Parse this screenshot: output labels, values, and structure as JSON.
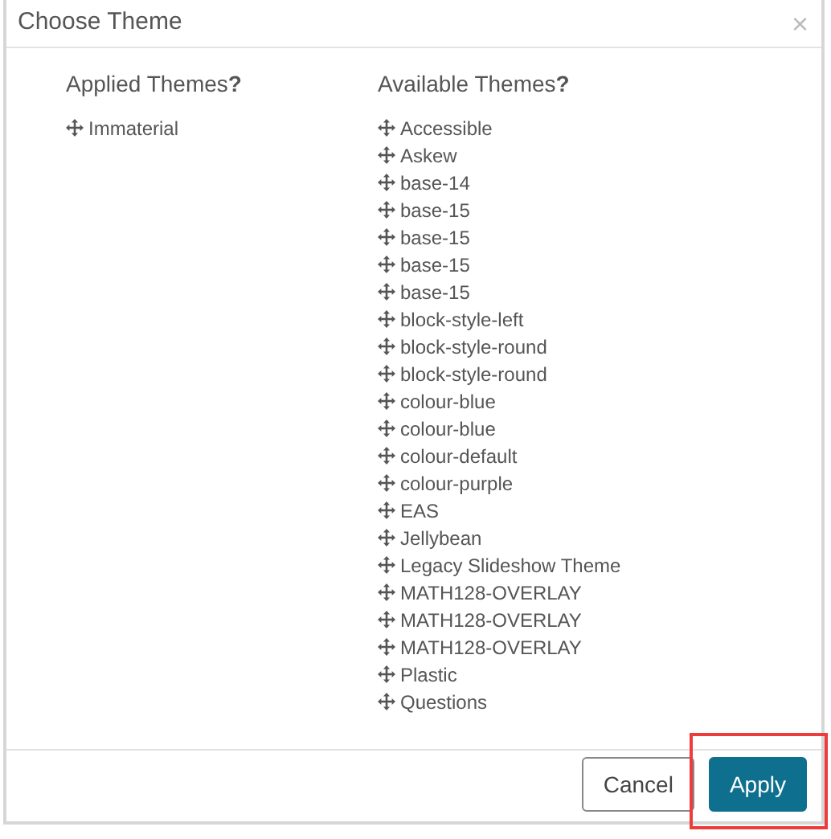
{
  "dialog": {
    "title": "Choose Theme",
    "close": "×"
  },
  "applied": {
    "heading": "Applied Themes",
    "help": "?",
    "items": [
      "Immaterial"
    ]
  },
  "available": {
    "heading": "Available Themes",
    "help": "?",
    "items": [
      "Accessible",
      "Askew",
      "base-14",
      "base-15",
      "base-15",
      "base-15",
      "base-15",
      "block-style-left",
      "block-style-round",
      "block-style-round",
      "colour-blue",
      "colour-blue",
      "colour-default",
      "colour-purple",
      "EAS",
      "Jellybean",
      "Legacy Slideshow Theme",
      "MATH128-OVERLAY",
      "MATH128-OVERLAY",
      "MATH128-OVERLAY",
      "Plastic",
      "Questions"
    ]
  },
  "buttons": [
    {
      "label": "Cancel",
      "kind": "secondary",
      "highlighted": false
    },
    {
      "label": "Apply",
      "kind": "primary",
      "highlighted": true
    }
  ]
}
